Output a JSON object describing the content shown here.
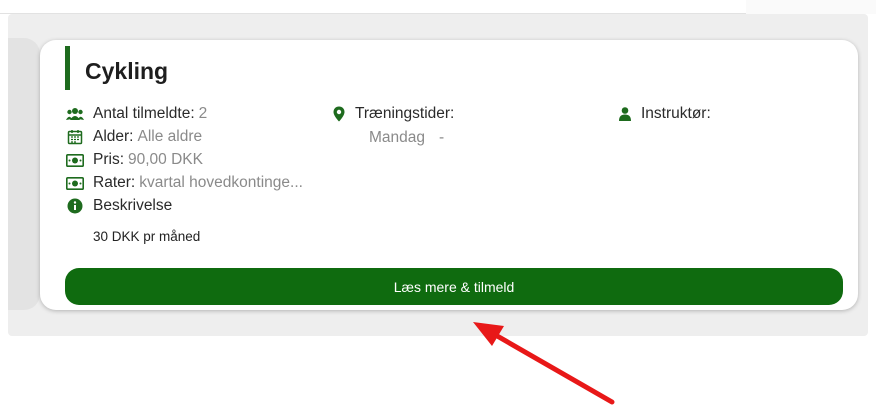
{
  "course": {
    "title": "Cykling",
    "participants_label": "Antal tilmeldte:",
    "participants_value": "2",
    "age_label": "Alder:",
    "age_value": "Alle aldre",
    "price_label": "Pris:",
    "price_value": "90,00 DKK",
    "rates_label": "Rater:",
    "rates_value": "kvartal hovedkontinge...",
    "description_label": "Beskrivelse",
    "description_value": "30 DKK pr måned",
    "training_label": "Træningstider:",
    "training_day": "Mandag",
    "training_time": "-",
    "instructor_label": "Instruktør:",
    "button_label": "Læs mere & tilmeld"
  },
  "colors": {
    "accent": "#0f6b0f",
    "arrow": "#e81818"
  },
  "icons": [
    "users-icon",
    "calendar-icon",
    "money-icon",
    "info-icon",
    "map-marker-icon",
    "user-icon",
    "arrow-annotation"
  ]
}
